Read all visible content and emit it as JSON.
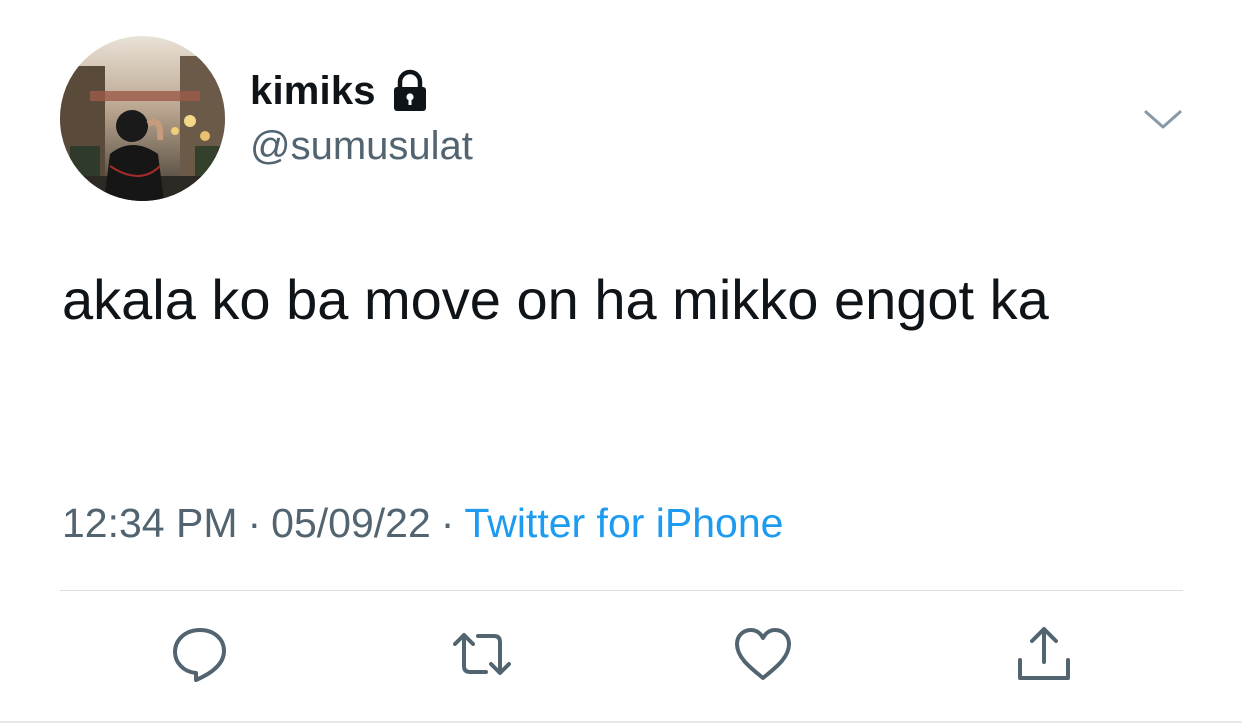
{
  "tweet": {
    "author": {
      "display_name": "kimiks",
      "handle": "@sumusulat",
      "protected_icon": "lock-icon",
      "avatar": "photo"
    },
    "text": "akala ko ba move on ha mikko engot ka",
    "meta": {
      "time": "12:34 PM",
      "separator": "·",
      "date": "05/09/22",
      "source": "Twitter for iPhone"
    },
    "menu_icon": "chevron-down-icon",
    "actions": [
      {
        "icon": "reply-icon"
      },
      {
        "icon": "retweet-icon"
      },
      {
        "icon": "like-icon"
      },
      {
        "icon": "share-icon"
      }
    ]
  },
  "colors": {
    "text": "#0f1419",
    "secondary": "#536471",
    "link": "#1d9bf0",
    "divider": "#d9dee2"
  }
}
